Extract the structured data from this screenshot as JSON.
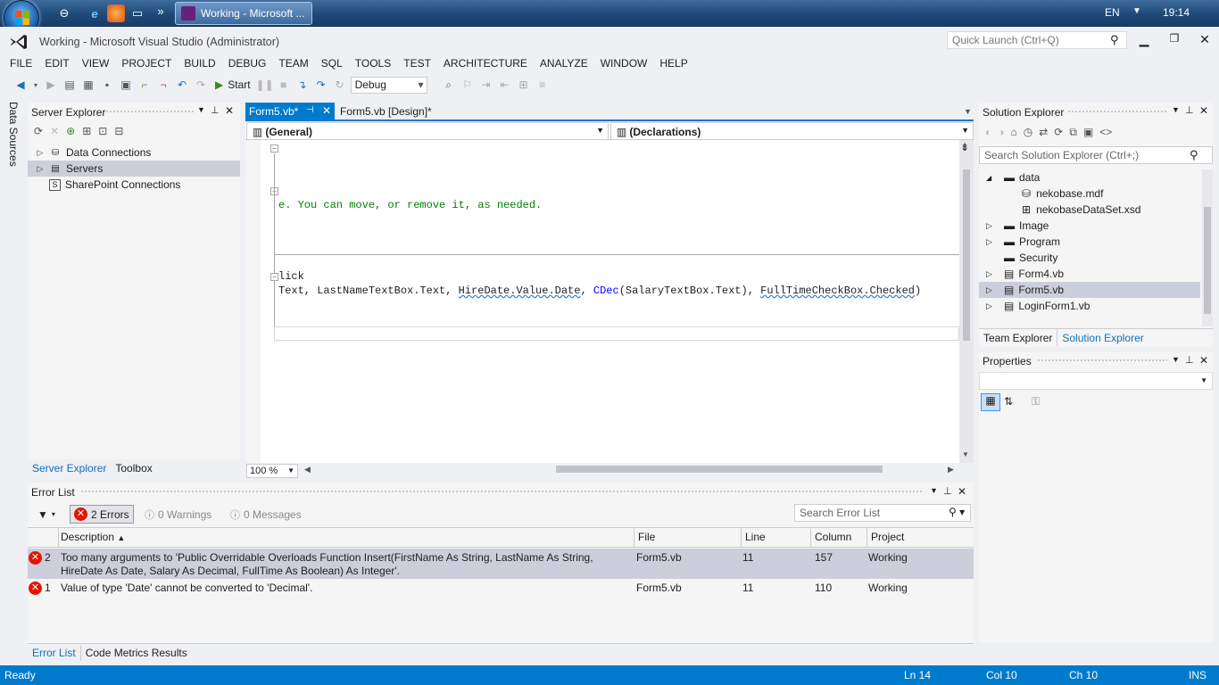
{
  "taskbar": {
    "active_task": "Working - Microsoft ...",
    "language": "EN",
    "clock": "19:14",
    "more_glyph": "»"
  },
  "window": {
    "title": "Working - Microsoft Visual Studio (Administrator)",
    "quick_launch_placeholder": "Quick Launch (Ctrl+Q)"
  },
  "menu": [
    "FILE",
    "EDIT",
    "VIEW",
    "PROJECT",
    "BUILD",
    "DEBUG",
    "TEAM",
    "SQL",
    "TOOLS",
    "TEST",
    "ARCHITECTURE",
    "ANALYZE",
    "WINDOW",
    "HELP"
  ],
  "toolbar": {
    "start_label": "Start",
    "config_value": "Debug"
  },
  "side_strip": {
    "data_sources_label": "Data Sources"
  },
  "server_explorer": {
    "title": "Server Explorer",
    "items": [
      {
        "label": "Data Connections",
        "icon": "database-connections-icon"
      },
      {
        "label": "Servers",
        "icon": "servers-icon"
      },
      {
        "label": "SharePoint Connections",
        "icon": "sharepoint-icon"
      }
    ],
    "tabs": [
      "Server Explorer",
      "Toolbox"
    ]
  },
  "editor": {
    "tabs": [
      "Form5.vb*",
      "Form5.vb [Design]*"
    ],
    "nav_left": "(General)",
    "nav_right": "(Declarations)",
    "line_comment": "e. You can move, or remove it, as needed.",
    "line_click": "lick",
    "line_insert_prefix": "Text, LastNameTextBox.Text, ",
    "line_insert_hire": "HireDate.Value.Date",
    "line_insert_sep1": ", ",
    "line_insert_cdec": "CDec",
    "line_insert_mid": "(SalaryTextBox.Text), ",
    "line_insert_fulltime": "FullTimeCheckBox.Checked",
    "line_insert_end": ")",
    "zoom": "100 %"
  },
  "solution_explorer": {
    "title": "Solution Explorer",
    "search_placeholder": "Search Solution Explorer (Ctrl+;)",
    "items": [
      {
        "label": "data",
        "expander": "◢"
      },
      {
        "label": "nekobase.mdf",
        "expander": ""
      },
      {
        "label": "nekobaseDataSet.xsd",
        "expander": ""
      },
      {
        "label": "Image",
        "expander": "▷"
      },
      {
        "label": "Program",
        "expander": "▷"
      },
      {
        "label": "Security",
        "expander": ""
      },
      {
        "label": "Form4.vb",
        "expander": "▷"
      },
      {
        "label": "Form5.vb",
        "expander": "▷"
      },
      {
        "label": "LoginForm1.vb",
        "expander": "▷"
      }
    ],
    "tabs": [
      "Team Explorer",
      "Solution Explorer"
    ]
  },
  "properties": {
    "title": "Properties"
  },
  "error_list": {
    "title": "Error List",
    "errors_btn": "2 Errors",
    "warnings_btn": "0 Warnings",
    "messages_btn": "0 Messages",
    "search_placeholder": "Search Error List",
    "columns": [
      "Description",
      "File",
      "Line",
      "Column",
      "Project"
    ],
    "rows": [
      {
        "num": "2",
        "description": "Too many arguments to 'Public Overridable Overloads Function Insert(FirstName As String, LastName As String, HireDate As Date, Salary As Decimal, FullTime As Boolean) As Integer'.",
        "file": "Form5.vb",
        "line": "11",
        "column": "157",
        "project": "Working"
      },
      {
        "num": "1",
        "description": "Value of type 'Date' cannot be converted to 'Decimal'.",
        "file": "Form5.vb",
        "line": "11",
        "column": "110",
        "project": "Working"
      }
    ],
    "tabs": [
      "Error List",
      "Code Metrics Results"
    ]
  },
  "status_bar": {
    "state": "Ready",
    "ln": "Ln 14",
    "col": "Col 10",
    "ch": "Ch 10",
    "mode": "INS"
  },
  "colors": {
    "accent": "#007acc",
    "error": "#e51400",
    "comment_green": "#008000",
    "keyword_blue": "#0000ff"
  }
}
